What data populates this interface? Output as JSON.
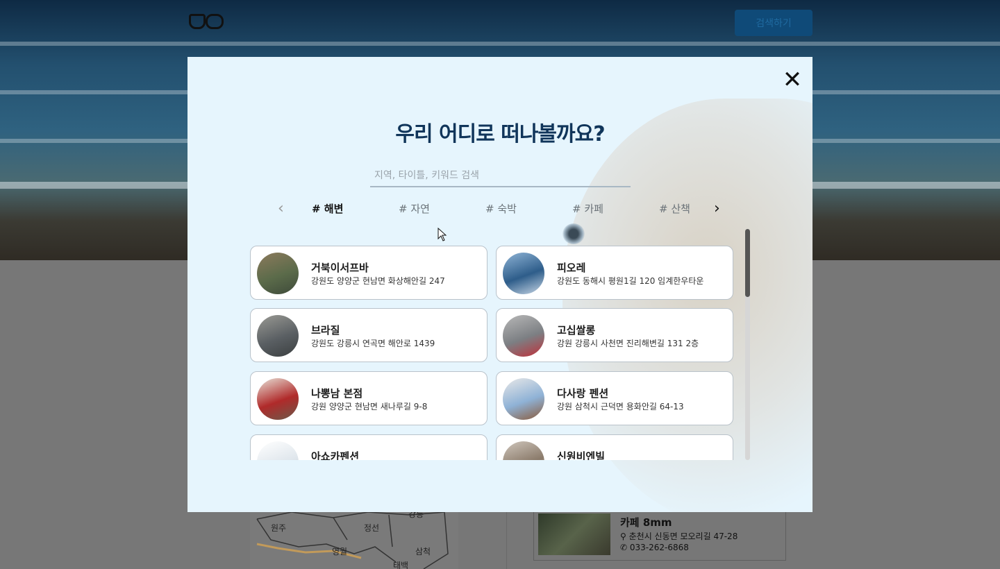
{
  "header": {
    "logo_alt": "cat-dog logo",
    "search_button": "검색하기"
  },
  "background_map_labels": [
    "원주",
    "정선",
    "영월",
    "삼척",
    "태백",
    "강릉"
  ],
  "background_card": {
    "title": "카페 8mm",
    "address": "춘천시 신동면 모오리길 47-28",
    "phone": "033-262-6868"
  },
  "modal": {
    "title": "우리 어디로 떠나볼까요?",
    "search_placeholder": "지역, 타이틀, 키워드 검색",
    "tags": [
      "# 해변",
      "# 자연",
      "# 숙박",
      "# 카페",
      "# 산책"
    ],
    "active_tag": "# 해변",
    "places": [
      {
        "name": "거북이서프바",
        "address": "강원도 양양군 현남면 화상해안길 247",
        "thumb": [
          "#5b6b4a",
          "#8c7a5c",
          "#3e4a3a"
        ]
      },
      {
        "name": "피오레",
        "address": "강원도 동해시 평원1길 120 임계한우타운",
        "thumb": [
          "#2e5d8a",
          "#8fb4d6",
          "#c8d7e6"
        ]
      },
      {
        "name": "브라질",
        "address": "강원도 강릉시 연곡면 해안로 1439",
        "thumb": [
          "#5a5f63",
          "#9a9a94",
          "#3b3f40"
        ]
      },
      {
        "name": "고십쌀롱",
        "address": "강원 강릉시 사천면 진리해변길 131 2층",
        "thumb": [
          "#7c7f83",
          "#b8b8b8",
          "#c0303a"
        ]
      },
      {
        "name": "나뽕남 본점",
        "address": "강원 양양군 현남면 새나루길 9-8",
        "thumb": [
          "#b02a2a",
          "#e8e2d8",
          "#6a5a4a"
        ]
      },
      {
        "name": "다사랑 펜션",
        "address": "강원 삼척시 근덕면 용화안길 64-13",
        "thumb": [
          "#8fb2d6",
          "#e8e8e8",
          "#8a5a3a"
        ]
      },
      {
        "name": "아쇼카펜션",
        "address": "",
        "thumb": [
          "#dfe6ec",
          "#ffffff",
          "#b0b8c0"
        ]
      },
      {
        "name": "신원비엔빌",
        "address": "",
        "thumb": [
          "#8a7a6a",
          "#cfc6bc",
          "#f0f0f0"
        ]
      }
    ]
  }
}
